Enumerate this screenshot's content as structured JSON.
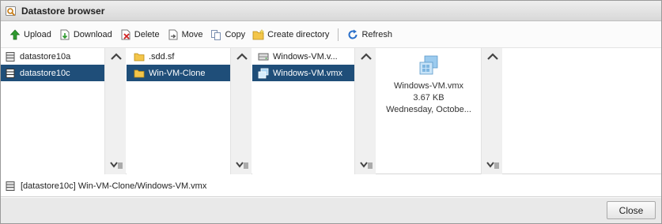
{
  "window": {
    "title": "Datastore browser"
  },
  "toolbar": {
    "upload": "Upload",
    "download": "Download",
    "delete": "Delete",
    "move": "Move",
    "copy": "Copy",
    "create_directory": "Create directory",
    "refresh": "Refresh"
  },
  "columns": {
    "datastores": [
      {
        "label": "datastore10a",
        "icon": "datastore-icon",
        "selected": false
      },
      {
        "label": "datastore10c",
        "icon": "datastore-icon",
        "selected": true
      }
    ],
    "folders": [
      {
        "label": ".sdd.sf",
        "icon": "folder-icon",
        "selected": false
      },
      {
        "label": "Win-VM-Clone",
        "icon": "folder-icon",
        "selected": true
      }
    ],
    "files": [
      {
        "label": "Windows-VM.v...",
        "icon": "disk-file-icon",
        "selected": false
      },
      {
        "label": "Windows-VM.vmx",
        "icon": "vm-config-file-icon",
        "selected": true
      }
    ]
  },
  "preview": {
    "name": "Windows-VM.vmx",
    "size": "3.67 KB",
    "modified": "Wednesday, Octobe..."
  },
  "path": {
    "text": "[datastore10c] Win-VM-Clone/Windows-VM.vmx"
  },
  "footer": {
    "close_label": "Close"
  },
  "colors": {
    "selection": "#1f4e79",
    "footer_bg": "#e9e9e9"
  }
}
